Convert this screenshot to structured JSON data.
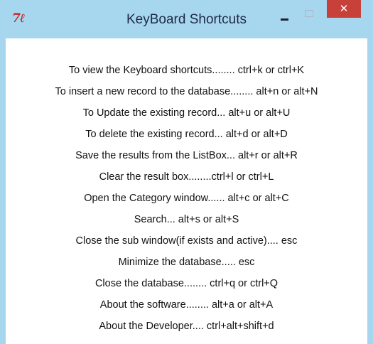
{
  "window": {
    "title": "KeyBoard Shortcuts",
    "app_icon": "tk-feather-icon",
    "controls": {
      "minimize": "minimize-icon",
      "maximize": "maximize-icon",
      "close_label": "✕"
    }
  },
  "shortcuts": [
    "To view the Keyboard shortcuts........ ctrl+k or ctrl+K",
    "To insert a new record to the database........ alt+n or alt+N",
    "To Update the existing record... alt+u or alt+U",
    "To delete the existing record... alt+d or alt+D",
    "Save the results from the ListBox... alt+r or alt+R",
    "Clear the result box........ctrl+l or ctrl+L",
    "Open the Category window...... alt+c or alt+C",
    "Search... alt+s or alt+S",
    "Close the sub window(if exists and active).... esc",
    "Minimize the database..... esc",
    "Close the database........ ctrl+q or ctrl+Q",
    "About the software........ alt+a or alt+A",
    "About the Developer.... ctrl+alt+shift+d"
  ],
  "colors": {
    "titlebar": "#a7d7ef",
    "close_button": "#c7403a",
    "icon_red": "#c8231e"
  }
}
